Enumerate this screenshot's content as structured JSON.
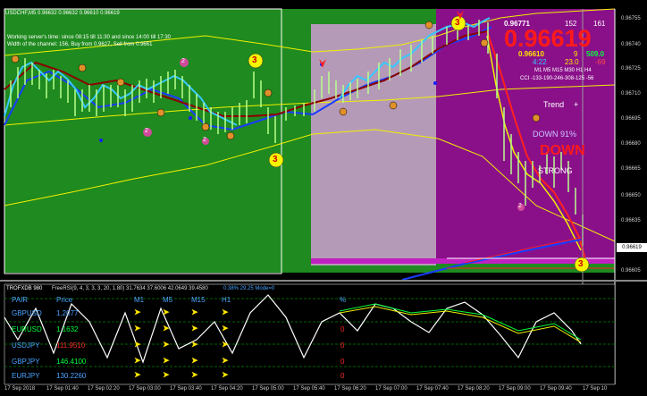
{
  "window": {
    "title": "USDCHF,M5 0.96632 0.96632 0.96610 0.96619"
  },
  "info": {
    "line1": "Working server's time: since 08:15 till 11:30 and since 14:00 till 17:30",
    "line2": "Width of the channel: 156, Buy from 0.9627, Sell from 0.9661"
  },
  "panel": {
    "ask": "0.96771",
    "spread": "152",
    "num161": "161",
    "big_price": "0.96619",
    "bid": "0.96610",
    "nine": "9",
    "v509": "509.0",
    "time": "4:22",
    "v230": "23.0",
    "m69": "-69",
    "tf_header": "M1  M5  M15  M30  H1  H4",
    "cci": "CCI -133-190-246-308-125 -56",
    "trend_label": "Trend",
    "trend_plus": "+",
    "down_label": "DOWN 91%",
    "down_big": "DOWN",
    "strong": "STRONG"
  },
  "markers": {
    "three": "3",
    "one": "1",
    "two": "2",
    "x": "x"
  },
  "price_axis": [
    "0.96755",
    "0.96740",
    "0.96725",
    "0.96710",
    "0.96695",
    "0.96680",
    "0.96665",
    "0.96650",
    "0.96635",
    "0.96619",
    "0.96605"
  ],
  "right_label": "0.96619",
  "sub": {
    "title": "TROFXDB 980",
    "indicator": "FreeRSI(9, 4, 3, 3, 3, 20, 1.80) 31.7634 37.6006 42.0649 39.4580",
    "mode": "0.38% 29.25 Mode=0",
    "headers": {
      "pair": "PAIR",
      "price": "Price",
      "m1": "M1",
      "m5": "M5",
      "m15": "M15",
      "h1": "H1",
      "pct": "%"
    },
    "rows": [
      {
        "pair": "GBPUSD",
        "price": "1.2077",
        "pct": "",
        "color": "#4aa3ff"
      },
      {
        "pair": "EURUSD",
        "price": "1.1632",
        "pct": "0",
        "color": "#00ff3c"
      },
      {
        "pair": "USDJPY",
        "price": "111.9510",
        "pct": "0",
        "color": "#ff2a2a"
      },
      {
        "pair": "GBPJPY",
        "price": "146.4100",
        "pct": "0",
        "color": "#00ff3c"
      },
      {
        "pair": "EURJPY",
        "price": "130.2260",
        "pct": "0",
        "color": "#4aa3ff"
      }
    ],
    "arrow": "➤",
    "levels": [
      "80",
      "60",
      "40",
      "20"
    ]
  },
  "time_axis": [
    "17 Sep 2018",
    "17 Sep 01:40",
    "17 Sep 02:20",
    "17 Sep 03:00",
    "17 Sep 03:40",
    "17 Sep 04:20",
    "17 Sep 05:00",
    "17 Sep 05:40",
    "17 Sep 06:20",
    "17 Sep 07:00",
    "17 Sep 07:40",
    "17 Sep 08:20",
    "17 Sep 09:00",
    "17 Sep 09:40",
    "17 Sep 10"
  ],
  "colors": {
    "green_bg": "#1f8a1f",
    "violet": "#8a108a",
    "lilac": "#b59ab8",
    "red": "#ff2020",
    "yellow": "#f0f000"
  }
}
